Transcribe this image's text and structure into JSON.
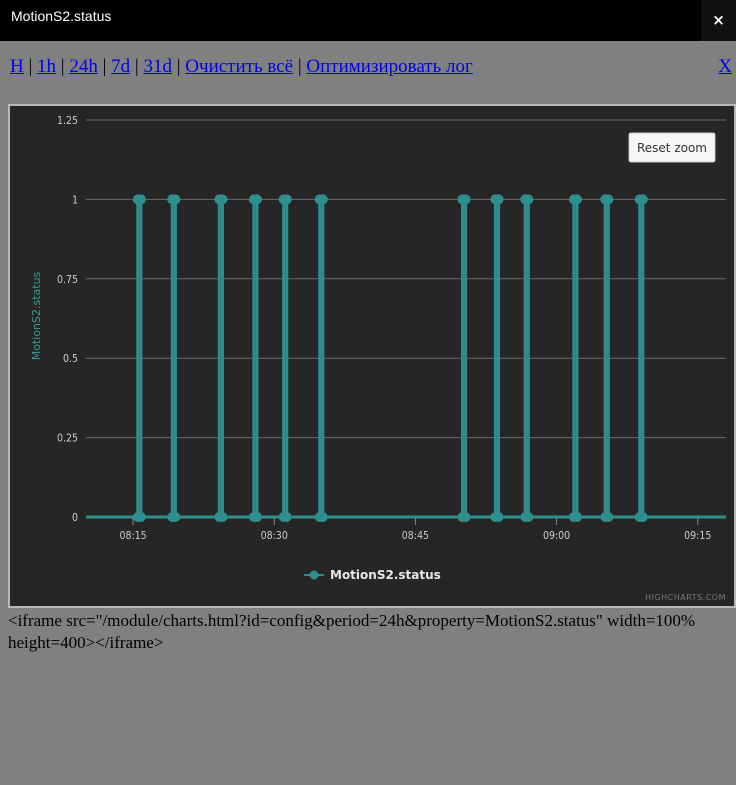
{
  "window": {
    "title": "MotionS2.status"
  },
  "close_icon": "×",
  "toolbar": {
    "links": [
      "H",
      "1h",
      "24h",
      "7d",
      "31d",
      "Очистить всё",
      "Оптимизировать лог"
    ],
    "separator": "|",
    "x_link": "X"
  },
  "chart": {
    "reset_zoom_label": "Reset zoom",
    "credits": "HIGHCHARTS.COM",
    "colors": {
      "background": "#262626",
      "grid": "#6a6a6a",
      "series": "#2f8f8f",
      "axis_title": "#2f9d9d"
    }
  },
  "chart_data": {
    "type": "line",
    "step": true,
    "ylabel": "MotionS2.status",
    "xlabel": "",
    "ylim": [
      0,
      1.25
    ],
    "yticks": [
      "0",
      "0.25",
      "0.5",
      "0.75",
      "1",
      "1.25"
    ],
    "xticks": [
      "08:15",
      "08:30",
      "08:45",
      "09:00",
      "09:15"
    ],
    "xlim": [
      "08:10",
      "09:18"
    ],
    "grid": true,
    "legend_position": "bottom-center",
    "series": [
      {
        "name": "MotionS2.status",
        "pulses": [
          [
            "08:15:30",
            "08:15:50"
          ],
          [
            "08:19:10",
            "08:19:30"
          ],
          [
            "08:24:10",
            "08:24:30"
          ],
          [
            "08:27:50",
            "08:28:10"
          ],
          [
            "08:31:00",
            "08:31:20"
          ],
          [
            "08:34:50",
            "08:35:10"
          ],
          [
            "08:50:00",
            "08:50:20"
          ],
          [
            "08:53:30",
            "08:53:50"
          ],
          [
            "08:56:40",
            "08:57:00"
          ],
          [
            "09:01:50",
            "09:02:10"
          ],
          [
            "09:05:10",
            "09:05:30"
          ],
          [
            "09:08:50",
            "09:09:10"
          ]
        ]
      }
    ]
  },
  "embed_code": "<iframe src=\"/module/charts.html?id=config&period=24h&property=MotionS2.status\" width=100% height=400></iframe>"
}
